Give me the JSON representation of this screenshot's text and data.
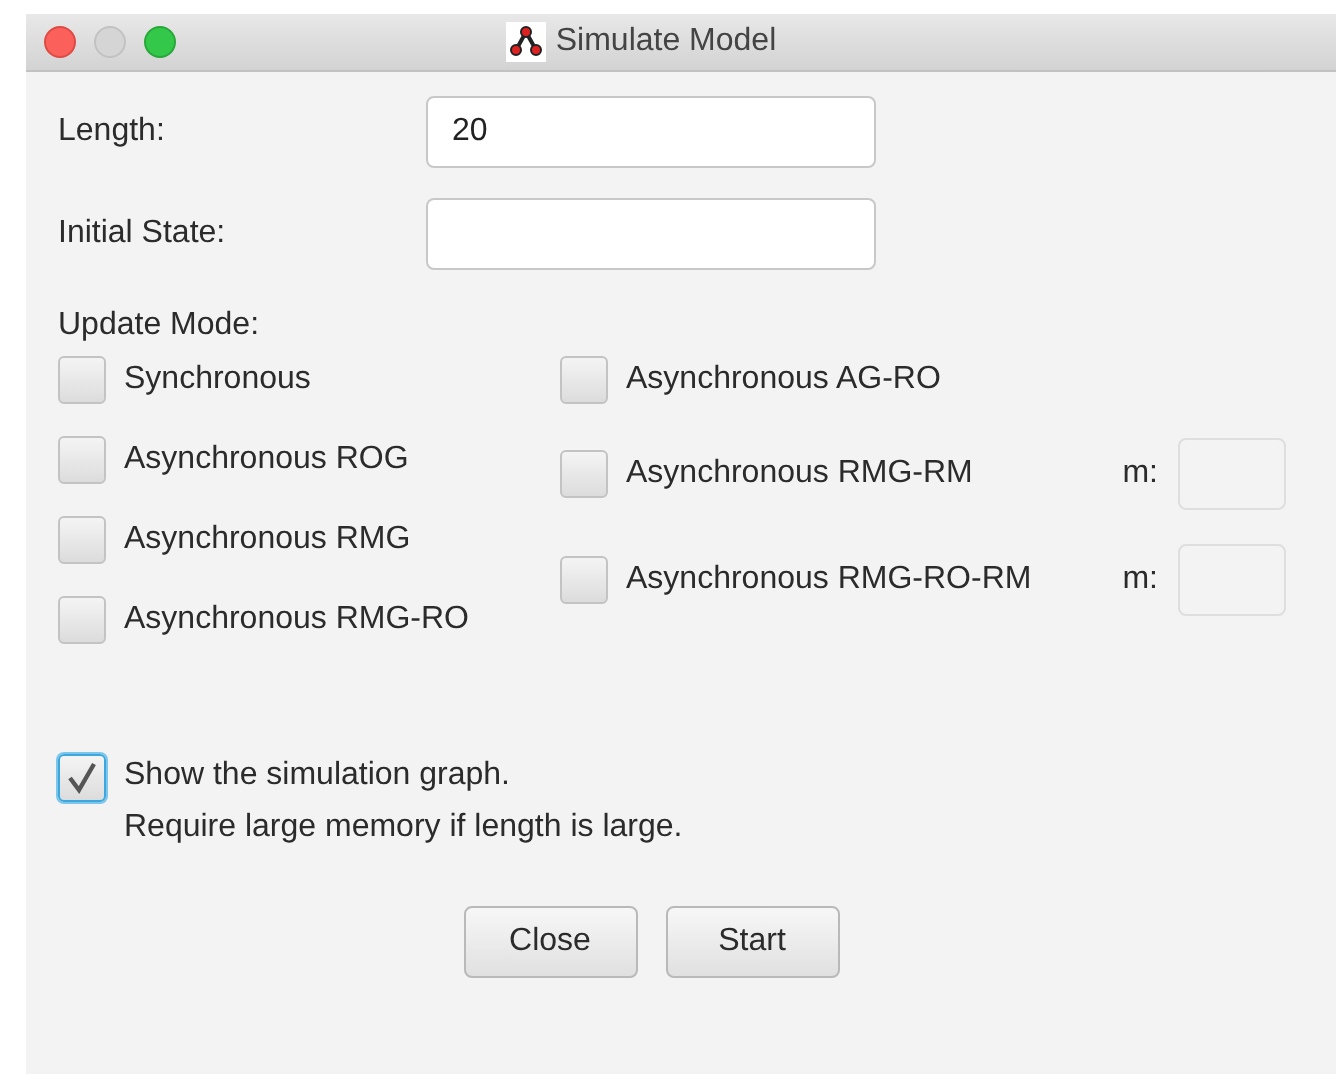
{
  "window": {
    "title": "Simulate Model"
  },
  "fields": [
    {
      "label": "Length:",
      "value": "20"
    },
    {
      "label": "Initial State:"
    }
  ],
  "update_mode": {
    "label": "Update Mode:",
    "left_options": [
      {
        "kind": "plain",
        "label": "Synchronous",
        "checked": false
      },
      {
        "kind": "plain",
        "label": "Asynchronous ROG",
        "checked": false
      },
      {
        "kind": "plain",
        "label": "Asynchronous RMG",
        "checked": false
      },
      {
        "kind": "plain",
        "label": "Asynchronous RMG-RO",
        "checked": false
      }
    ],
    "right_options": [
      {
        "kind": "plain",
        "label": "Asynchronous AG-RO",
        "checked": false
      },
      {
        "kind": "with_m",
        "label": "Asynchronous RMG-RM",
        "checked": false,
        "m_label": "m:"
      },
      {
        "kind": "with_m",
        "label": "Asynchronous RMG-RO-RM",
        "checked": false,
        "m_label": "m:"
      }
    ]
  },
  "show_graph": {
    "label": "Show the simulation graph.",
    "note": "Require large memory if length is large.",
    "checked": true
  },
  "buttons": [
    "Close",
    "Start"
  ]
}
